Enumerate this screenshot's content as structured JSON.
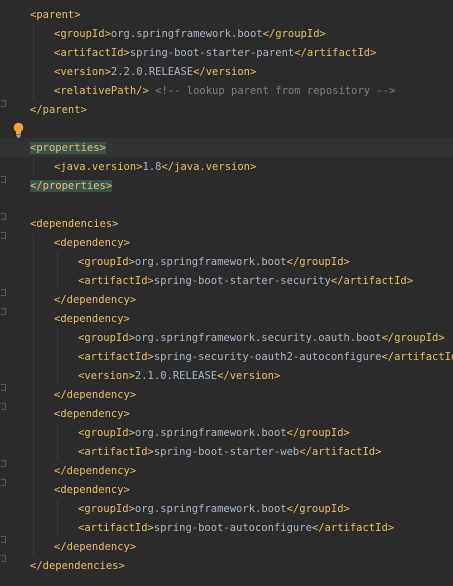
{
  "colors": {
    "background": "#2b2b2b",
    "tag": "#e8bf6a",
    "text": "#a9b7c6",
    "comment": "#808080",
    "highlight": "#3b514d",
    "bulb": "#f0a732"
  },
  "icons": {
    "gutter": "fold-marker-icon",
    "intention": "lightbulb-icon"
  },
  "lines": [
    {
      "indent": 0,
      "open": "<parent>",
      "text": "",
      "close": "",
      "comment": ""
    },
    {
      "indent": 1,
      "open": "<groupId>",
      "text": "org.springframework.boot",
      "close": "</groupId>",
      "comment": ""
    },
    {
      "indent": 1,
      "open": "<artifactId>",
      "text": "spring-boot-starter-parent",
      "close": "</artifactId>",
      "comment": ""
    },
    {
      "indent": 1,
      "open": "<version>",
      "text": "2.2.0.RELEASE",
      "close": "</version>",
      "comment": ""
    },
    {
      "indent": 1,
      "open": "<relativePath/>",
      "text": " ",
      "close": "",
      "comment": "<!-- lookup parent from repository -->"
    },
    {
      "indent": 0,
      "open": "</parent>",
      "text": "",
      "close": "",
      "comment": ""
    },
    {
      "indent": 0,
      "open": "",
      "text": "",
      "close": "",
      "comment": ""
    },
    {
      "indent": 0,
      "open": "<properties>",
      "text": "",
      "close": "",
      "comment": ""
    },
    {
      "indent": 1,
      "open": "<java.version>",
      "text": "1.8",
      "close": "</java.version>",
      "comment": ""
    },
    {
      "indent": 0,
      "open": "</properties>",
      "text": "",
      "close": "",
      "comment": ""
    },
    {
      "indent": 0,
      "open": "",
      "text": "",
      "close": "",
      "comment": ""
    },
    {
      "indent": 0,
      "open": "<dependencies>",
      "text": "",
      "close": "",
      "comment": ""
    },
    {
      "indent": 1,
      "open": "<dependency>",
      "text": "",
      "close": "",
      "comment": ""
    },
    {
      "indent": 2,
      "open": "<groupId>",
      "text": "org.springframework.boot",
      "close": "</groupId>",
      "comment": ""
    },
    {
      "indent": 2,
      "open": "<artifactId>",
      "text": "spring-boot-starter-security",
      "close": "</artifactId>",
      "comment": ""
    },
    {
      "indent": 1,
      "open": "</dependency>",
      "text": "",
      "close": "",
      "comment": ""
    },
    {
      "indent": 1,
      "open": "<dependency>",
      "text": "",
      "close": "",
      "comment": ""
    },
    {
      "indent": 2,
      "open": "<groupId>",
      "text": "org.springframework.security.oauth.boot",
      "close": "</groupId>",
      "comment": ""
    },
    {
      "indent": 2,
      "open": "<artifactId>",
      "text": "spring-security-oauth2-autoconfigure",
      "close": "</artifactId>",
      "comment": ""
    },
    {
      "indent": 2,
      "open": "<version>",
      "text": "2.1.0.RELEASE",
      "close": "</version>",
      "comment": ""
    },
    {
      "indent": 1,
      "open": "</dependency>",
      "text": "",
      "close": "",
      "comment": ""
    },
    {
      "indent": 1,
      "open": "<dependency>",
      "text": "",
      "close": "",
      "comment": ""
    },
    {
      "indent": 2,
      "open": "<groupId>",
      "text": "org.springframework.boot",
      "close": "</groupId>",
      "comment": ""
    },
    {
      "indent": 2,
      "open": "<artifactId>",
      "text": "spring-boot-starter-web",
      "close": "</artifactId>",
      "comment": ""
    },
    {
      "indent": 1,
      "open": "</dependency>",
      "text": "",
      "close": "",
      "comment": ""
    },
    {
      "indent": 1,
      "open": "<dependency>",
      "text": "",
      "close": "",
      "comment": ""
    },
    {
      "indent": 2,
      "open": "<groupId>",
      "text": "org.springframework.boot",
      "close": "</groupId>",
      "comment": ""
    },
    {
      "indent": 2,
      "open": "<artifactId>",
      "text": "spring-boot-autoconfigure",
      "close": "</artifactId>",
      "comment": ""
    },
    {
      "indent": 1,
      "open": "</dependency>",
      "text": "",
      "close": "",
      "comment": ""
    },
    {
      "indent": 0,
      "open": "</dependencies>",
      "text": "",
      "close": "",
      "comment": ""
    }
  ]
}
